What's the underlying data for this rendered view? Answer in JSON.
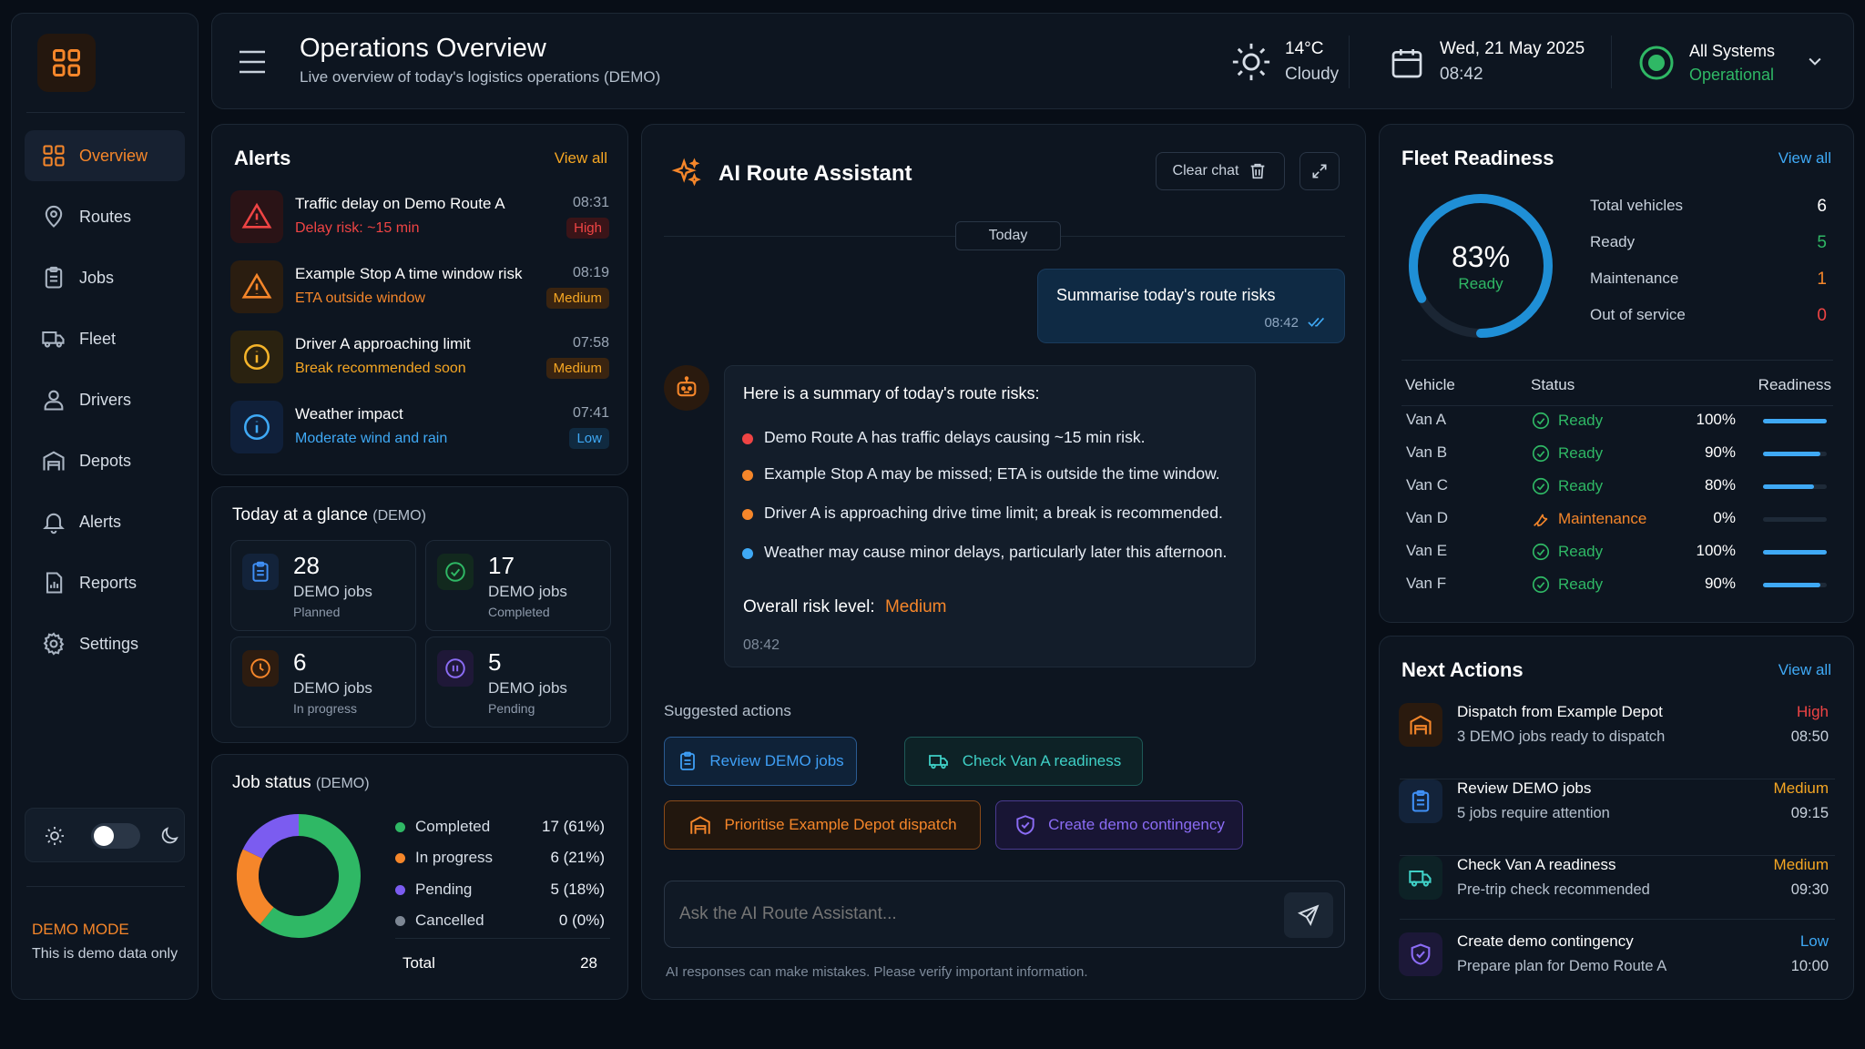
{
  "sidebar": {
    "items": [
      {
        "label": "Overview",
        "icon": "grid-icon",
        "active": true
      },
      {
        "label": "Routes",
        "icon": "map-pin-icon"
      },
      {
        "label": "Jobs",
        "icon": "clipboard-icon"
      },
      {
        "label": "Fleet",
        "icon": "truck-icon"
      },
      {
        "label": "Drivers",
        "icon": "user-icon"
      },
      {
        "label": "Depots",
        "icon": "warehouse-icon"
      },
      {
        "label": "Alerts",
        "icon": "bell-icon"
      },
      {
        "label": "Reports",
        "icon": "report-icon"
      },
      {
        "label": "Settings",
        "icon": "gear-icon"
      }
    ],
    "demo_mode_label": "DEMO MODE",
    "demo_mode_text": "This is demo data only",
    "theme_toggle": "light"
  },
  "header": {
    "title": "Operations Overview",
    "subtitle": "Live overview of today's logistics operations (DEMO)",
    "weather_temp": "14°C",
    "weather_desc": "Cloudy",
    "date": "Wed, 21 May 2025",
    "time": "08:42",
    "status_line1": "All Systems",
    "status_line2": "Operational"
  },
  "alerts": {
    "title": "Alerts",
    "view_all": "View all",
    "items": [
      {
        "title": "Traffic delay on Demo Route A",
        "subtitle": "Delay risk: ~15 min",
        "time": "08:31",
        "priority": "High"
      },
      {
        "title": "Example Stop A time window risk",
        "subtitle": "ETA outside window",
        "time": "08:19",
        "priority": "Medium"
      },
      {
        "title": "Driver A approaching limit",
        "subtitle": "Break recommended soon",
        "time": "07:58",
        "priority": "Medium"
      },
      {
        "title": "Weather impact",
        "subtitle": "Moderate wind and rain",
        "time": "07:41",
        "priority": "Low"
      }
    ]
  },
  "glance": {
    "title": "Today at a glance",
    "tag": "(DEMO)",
    "cards": [
      {
        "value": "28",
        "label": "DEMO jobs",
        "sub": "Planned"
      },
      {
        "value": "17",
        "label": "DEMO jobs",
        "sub": "Completed"
      },
      {
        "value": "6",
        "label": "DEMO jobs",
        "sub": "In progress"
      },
      {
        "value": "5",
        "label": "DEMO jobs",
        "sub": "Pending"
      }
    ]
  },
  "job_status": {
    "title": "Job status",
    "tag": "(DEMO)",
    "total_label": "Total",
    "total_value": "28",
    "colors": {
      "completed": "#2fb865",
      "in_progress": "#f5862a",
      "pending": "#7b5cf0",
      "cancelled": "#7d8794"
    }
  },
  "chart_data": {
    "type": "pie",
    "categories": [
      "Completed",
      "In progress",
      "Pending",
      "Cancelled"
    ],
    "values": [
      17,
      6,
      5,
      0
    ],
    "labels": [
      "17 (61%)",
      "6 (21%)",
      "5 (18%)",
      "0 (0%)"
    ]
  },
  "chat": {
    "title": "AI Route Assistant",
    "clear_label": "Clear chat",
    "day_label": "Today",
    "user_message": "Summarise today's route risks",
    "user_time": "08:42",
    "bot_intro": "Here is a summary of today's route risks:",
    "bullets": [
      {
        "text": "Demo Route A has traffic delays causing ~15 min risk.",
        "color": "#ef4444"
      },
      {
        "text": "Example Stop A may be missed; ETA is outside the time window.",
        "color": "#f5862a"
      },
      {
        "text": "Driver A is approaching drive time limit; a break is recommended.",
        "color": "#f5862a"
      },
      {
        "text": "Weather may cause minor delays, particularly later this afternoon.",
        "color": "#3fa9f5"
      }
    ],
    "risk_label": "Overall risk level:",
    "risk_value": "Medium",
    "bot_time": "08:42",
    "suggested_label": "Suggested actions",
    "suggestions": [
      {
        "label": "Review DEMO jobs"
      },
      {
        "label": "Check Van A readiness"
      },
      {
        "label": "Prioritise Example Depot dispatch"
      },
      {
        "label": "Create demo contingency"
      }
    ],
    "input_placeholder": "Ask the AI Route Assistant...",
    "disclaimer": "AI responses can make mistakes. Please verify important information."
  },
  "fleet": {
    "title": "Fleet Readiness",
    "view_all": "View all",
    "readiness_value": "83%",
    "readiness_fraction": 0.83,
    "readiness_label": "Ready",
    "stats": [
      {
        "label": "Total vehicles",
        "value": "6"
      },
      {
        "label": "Ready",
        "value": "5"
      },
      {
        "label": "Maintenance",
        "value": "1"
      },
      {
        "label": "Out of service",
        "value": "0"
      }
    ],
    "columns": [
      "Vehicle",
      "Status",
      "Readiness"
    ],
    "vehicles": [
      {
        "name": "Van A",
        "status": "Ready",
        "readiness": "100%",
        "fraction": 1.0
      },
      {
        "name": "Van B",
        "status": "Ready",
        "readiness": "90%",
        "fraction": 0.9
      },
      {
        "name": "Van C",
        "status": "Ready",
        "readiness": "80%",
        "fraction": 0.8
      },
      {
        "name": "Van D",
        "status": "Maintenance",
        "readiness": "0%",
        "fraction": 0.0
      },
      {
        "name": "Van E",
        "status": "Ready",
        "readiness": "100%",
        "fraction": 1.0
      },
      {
        "name": "Van F",
        "status": "Ready",
        "readiness": "90%",
        "fraction": 0.9
      }
    ]
  },
  "next_actions": {
    "title": "Next Actions",
    "view_all": "View all",
    "items": [
      {
        "title": "Dispatch from Example Depot",
        "subtitle": "3 DEMO jobs ready to dispatch",
        "priority": "High",
        "time": "08:50"
      },
      {
        "title": "Review DEMO jobs",
        "subtitle": "5 jobs require attention",
        "priority": "Medium",
        "time": "09:15"
      },
      {
        "title": "Check Van A readiness",
        "subtitle": "Pre-trip check recommended",
        "priority": "Medium",
        "time": "09:30"
      },
      {
        "title": "Create demo contingency",
        "subtitle": "Prepare plan for Demo Route A",
        "priority": "Low",
        "time": "10:00"
      }
    ]
  }
}
